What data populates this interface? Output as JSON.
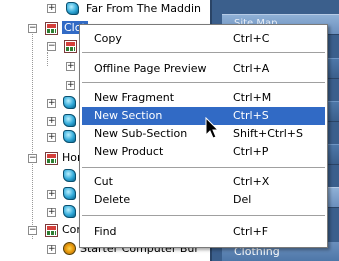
{
  "tree": {
    "nodes": [
      {
        "label": "Far From The Maddin"
      },
      {
        "label": "Clot"
      },
      {
        "label": "Hom"
      },
      {
        "label": "Com"
      },
      {
        "label": "Starter Computer Bur"
      }
    ],
    "expander_plus": "+",
    "expander_minus": "−"
  },
  "right_panel": {
    "header": "Site Map",
    "tab": "Clothing"
  },
  "context_menu": {
    "items": [
      {
        "label": "Copy",
        "shortcut": "Ctrl+C"
      },
      {
        "label": "Offline Page Preview",
        "shortcut": "Ctrl+A"
      },
      {
        "label": "New Fragment",
        "shortcut": "Ctrl+M"
      },
      {
        "label": "New Section",
        "shortcut": "Ctrl+S",
        "highlighted": true
      },
      {
        "label": "New Sub-Section",
        "shortcut": "Shift+Ctrl+S"
      },
      {
        "label": "New Product",
        "shortcut": "Ctrl+P"
      },
      {
        "label": "Cut",
        "shortcut": "Ctrl+X"
      },
      {
        "label": "Delete",
        "shortcut": "Del"
      },
      {
        "label": "Find",
        "shortcut": "Ctrl+F"
      }
    ]
  },
  "colors": {
    "highlight": "#316ac5",
    "panel": "#3b5f8c"
  }
}
